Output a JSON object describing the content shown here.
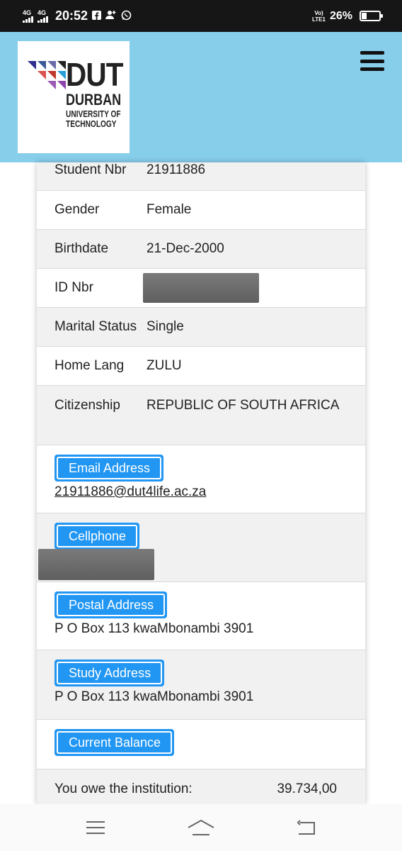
{
  "status_bar": {
    "network1": "4G",
    "network2": "4G",
    "time": "20:52",
    "lte_label": "Vo) LTE1",
    "battery": "26%",
    "battery_level": 0.26,
    "icons": [
      "facebook-icon",
      "person-add-icon",
      "whatsapp-icon"
    ]
  },
  "header": {
    "logo": {
      "acronym": "DUT",
      "name": "DURBAN",
      "subtitle": "UNIVERSITY OF TECHNOLOGY"
    },
    "menu_icon": "hamburger-icon",
    "background": "#87ceeb"
  },
  "profile": {
    "rows": [
      {
        "label": "Student Nbr",
        "value": "21911886"
      },
      {
        "label": "Gender",
        "value": "Female"
      },
      {
        "label": "Birthdate",
        "value": "21-Dec-2000"
      },
      {
        "label": "ID Nbr",
        "value": ""
      },
      {
        "label": "Marital Status",
        "value": "Single"
      },
      {
        "label": "Home Lang",
        "value": "ZULU"
      },
      {
        "label": "Citizenship",
        "value": "REPUBLIC OF SOUTH AFRICA"
      }
    ]
  },
  "contact": {
    "email_label": "Email Address",
    "email_value": "21911886@dut4life.ac.za",
    "cellphone_label": "Cellphone",
    "postal_label": "Postal Address",
    "postal_value": "P O Box 113 kwaMbonambi 3901",
    "study_label": "Study Address",
    "study_value": "P O Box 113 kwaMbonambi 3901"
  },
  "balance": {
    "label": "Current Balance",
    "owe_label": "You owe the institution:",
    "owe_value": "39.734,00"
  },
  "colors": {
    "accent": "#2196f3",
    "header": "#87ceeb",
    "row_alt": "#f1f1f1"
  },
  "nav": {
    "icons": [
      "menu-lines-icon",
      "home-icon",
      "back-icon"
    ]
  }
}
